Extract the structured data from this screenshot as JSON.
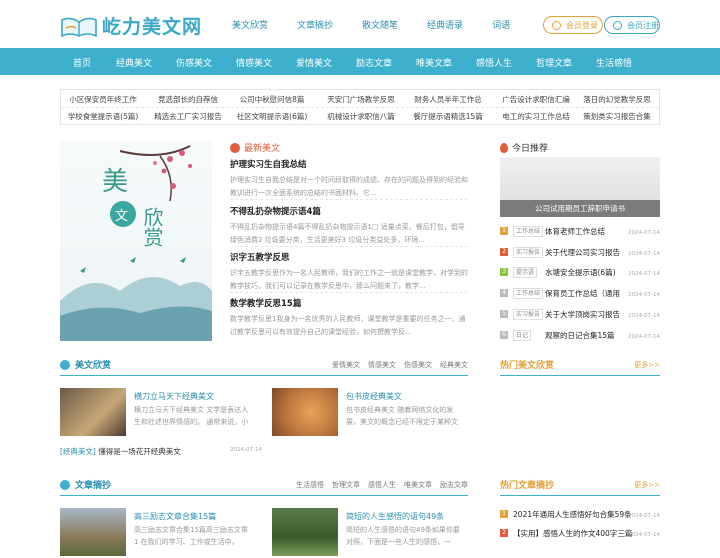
{
  "logo": {
    "text": "屹力美文网"
  },
  "topnav": [
    "美文欣赏",
    "文章摘抄",
    "散文随笔",
    "经典语录",
    "词语"
  ],
  "auth": {
    "login": "会员登录",
    "register": "会员注册"
  },
  "mainnav": [
    "首页",
    "经典美文",
    "伤感美文",
    "情感美文",
    "爱情美文",
    "励志文章",
    "唯美文章",
    "感悟人生",
    "哲理文章",
    "生活感悟"
  ],
  "tags": [
    [
      "小区保安员年终工作",
      "竞选部长的自荐信",
      "公司中秋慰问信8篇",
      "天安门广场教学反思",
      "财务人员半年工作总",
      "广告设计求职信汇编",
      "落日的幻觉教学反思"
    ],
    [
      "学校食堂提示语(5篇)",
      "精选去工厂实习报告",
      "社区文明提示语(6篇)",
      "机械设计求职信八篇",
      "餐厅提示语精选15篇",
      "电工的实习工作总结",
      "策划类实习报告合集"
    ]
  ],
  "banner": {
    "title1": "美",
    "title2": "文",
    "title3": "欣赏"
  },
  "latest": {
    "heading": "最新美文",
    "articles": [
      {
        "title": "护理实习生自我总结",
        "summary": "护理实习生自我总结是对一个时间段取得的成绩、存在的问题及得到的经验和教训进行一次全面系统的总结的书面材料。它..."
      },
      {
        "title": "不得乱扔杂物提示语4篇",
        "summary": "不得乱扔杂物提示语4篇不得乱扔杂物提示语1□ 适量点菜，餐后打包，倡导绿色消费2 垃圾要分类，生活更美好3 垃圾分类益处多，环境..."
      },
      {
        "title": "识字五教学反思",
        "summary": "识字五教学反思作为一名人民教师，我们的工作之一就是课堂教学，对学到的教学技巧，我们可以记录在教学反思中，那么问题来了，教学..."
      },
      {
        "title": "数学教学反思15篇",
        "summary": "数学教学反思1我身为一名优秀的人民教师，课堂教学是重要的任务之一，通过教学反思可以有效提升自己的课堂经验，如何撰教学反..."
      }
    ]
  },
  "recommend": {
    "heading": "今日推荐",
    "caption": "公司试用期员工辞职申请书",
    "items": [
      {
        "n": "1",
        "cat": "工作总结",
        "title": "体育老师工作总结",
        "date": "2024-07-14"
      },
      {
        "n": "2",
        "cat": "实习报告",
        "title": "关于代理公司实习报告",
        "date": "2024-07-14"
      },
      {
        "n": "3",
        "cat": "提示语",
        "title": "水塘安全提示语(6篇)",
        "date": "2024-07-14"
      },
      {
        "n": "4",
        "cat": "工作总结",
        "title": "保育员工作总结（通用",
        "date": "2024-07-14"
      },
      {
        "n": "5",
        "cat": "实习报告",
        "title": "关于大学顶岗实习报告",
        "date": "2024-07-14"
      },
      {
        "n": "6",
        "cat": "日记",
        "title": "观察的日记合集15篇",
        "date": "2024-07-14"
      }
    ]
  },
  "sec1": {
    "title": "美文欣赏",
    "links": [
      "爱情美文",
      "情感美文",
      "伤感美文",
      "经典美文"
    ],
    "cards": [
      {
        "title": "横刀立马天下经典美文",
        "summary": "横刀立马天下经典美文 文学是表达人生和社述世界情感的。 通常来说，小"
      },
      {
        "title": "包书皮经典美文",
        "summary": "包书皮经典美文 随着网络文化的发展，美文的概念已经不限定于某种文"
      }
    ],
    "link": {
      "tag": "[经典美文]",
      "title": "懂得是一场花开经典美文",
      "date": "2024-07-14"
    }
  },
  "hot1": {
    "title": "热门美文欣赏",
    "more": "更多>>"
  },
  "sec2": {
    "title": "文章摘抄",
    "links": [
      "生活感悟",
      "哲理文章",
      "感悟人生",
      "唯美文章",
      "励志文章"
    ],
    "cards": [
      {
        "title": "高三励志文章合集15篇",
        "summary": "高三励志文章合集15篇高三励志文章1 在我们的学习、工作或生活中，"
      },
      {
        "title": "简短的人生感悟的语句49条",
        "summary": "简短的人生感悟的语句49条如果你要对照，下面是一些人生的感悟，一"
      }
    ]
  },
  "hot2": {
    "title": "热门文章摘抄",
    "more": "更多>>",
    "items": [
      {
        "n": "1",
        "title": "2021年通用人生感悟好句合集59条",
        "date": "2024-07-14"
      },
      {
        "n": "2",
        "title": "【实用】感悟人生的作文400字三篇",
        "date": "2024-07-14"
      }
    ]
  },
  "colors": {
    "brand": "#3cb0cc",
    "accent": "#e2a33c",
    "hot": "#e25b3a"
  }
}
